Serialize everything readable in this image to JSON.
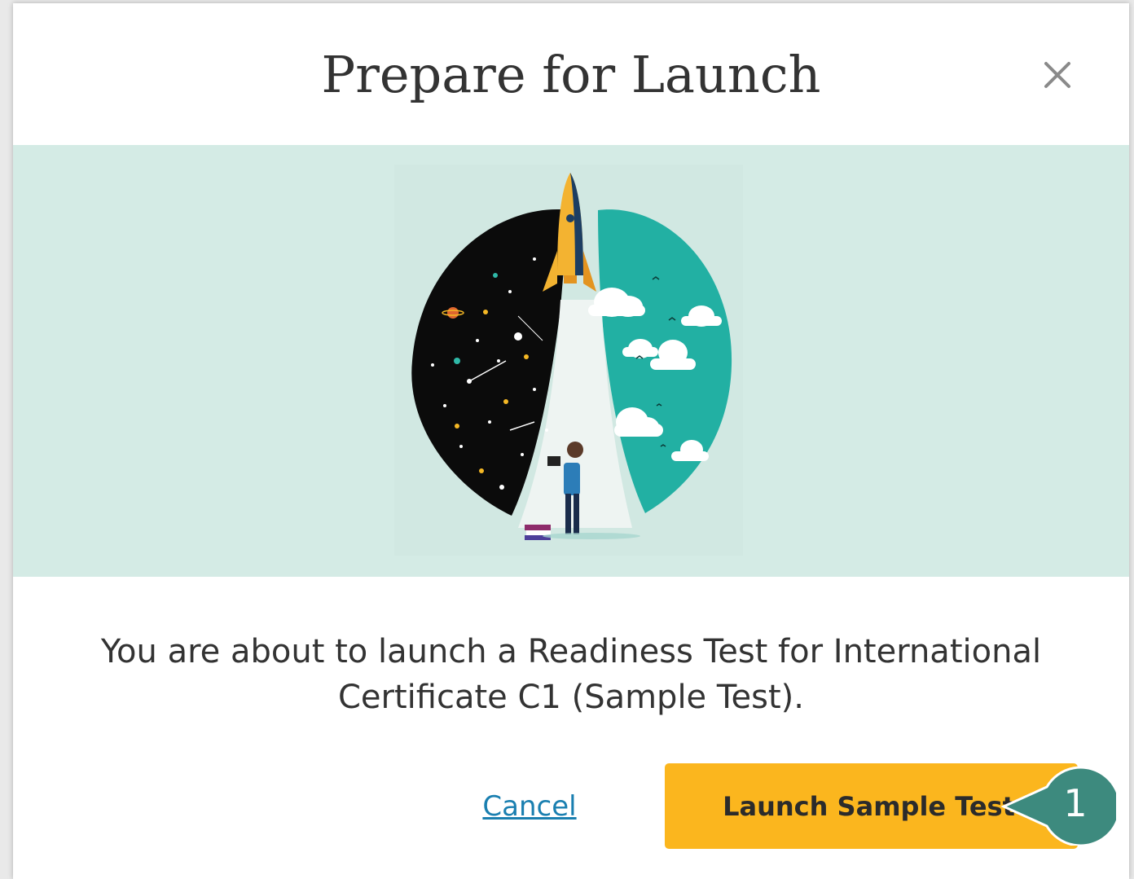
{
  "modal": {
    "title": "Prepare for Launch",
    "close_icon": "close-icon",
    "message": "You are about to launch a Readiness Test for International Certificate C1 (Sample Test).",
    "cancel_label": "Cancel",
    "launch_label": "Launch Sample Test"
  },
  "callout": {
    "number": "1"
  },
  "colors": {
    "hero_background": "#d4ebe5",
    "launch_button": "#fbb61e",
    "link": "#1a7fb0",
    "callout": "#3d8a7e",
    "space": "#0b0b0b",
    "sky": "#22b0a3"
  },
  "illustration": {
    "name": "rocket-launch-illustration"
  }
}
